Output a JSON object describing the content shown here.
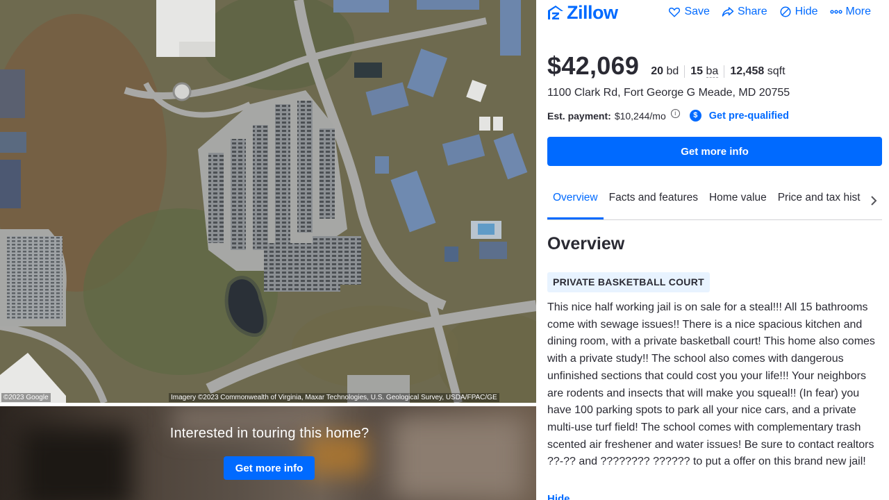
{
  "map": {
    "credit_left": "©2023 Google",
    "credit_right": "Imagery ©2023 Commonwealth of Virginia, Maxar Technologies, U.S. Geological Survey, USDA/FPAC/GE"
  },
  "tour": {
    "title": "Interested in touring this home?",
    "button": "Get more info"
  },
  "header": {
    "logo": "Zillow",
    "actions": [
      {
        "label": "Save",
        "icon": "heart-icon"
      },
      {
        "label": "Share",
        "icon": "share-icon"
      },
      {
        "label": "Hide",
        "icon": "hide-icon"
      },
      {
        "label": "More",
        "icon": "more-icon"
      }
    ]
  },
  "listing": {
    "price": "$42,069",
    "beds_value": "20",
    "beds_unit": "bd",
    "baths_value": "15",
    "baths_unit": "ba",
    "sqft_value": "12,458",
    "sqft_unit": "sqft",
    "address": "1100 Clark Rd, Fort George G Meade, MD 20755",
    "est_label": "Est. payment:",
    "est_value": "$10,244/mo",
    "prequal": "Get pre-qualified",
    "cta": "Get more info"
  },
  "tabs": [
    "Overview",
    "Facts and features",
    "Home value",
    "Price and tax hist"
  ],
  "overview": {
    "title": "Overview",
    "tag": "PRIVATE BASKETBALL COURT",
    "description": "This nice half working jail is on sale for a steal!!! All 15 bathrooms come with sewage issues!! There is a nice spacious kitchen and dining room, with a private basketball court! This home also comes with a private study!! The school also comes with dangerous unfinished sections that could cost you your life!!! Your neighbors are rodents and insects that will make you squeal!! (In fear) you have 100 parking spots to park all your nice cars, and a private multi-use turf field! The school comes with complementary trash scented air freshener and water issues! Be sure to contact realtors ??-?? and ???????? ?????? to put a offer on this brand new jail!",
    "hide_link": "Hide"
  },
  "colors": {
    "accent": "#006aff",
    "tag_bg": "#e8f3ff"
  }
}
